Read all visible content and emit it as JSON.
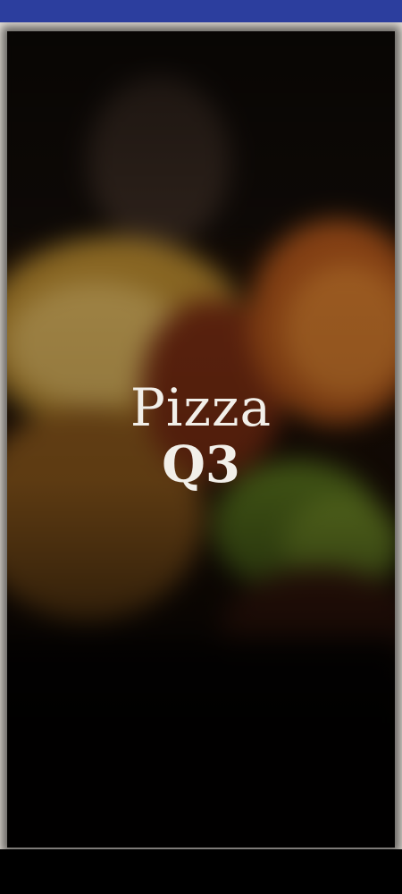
{
  "splash": {
    "title_line1": "Pizza",
    "title_line2": "Q3"
  },
  "colors": {
    "status_bar": "#2c3e9e",
    "title_text": "#f2efe9",
    "frame": "#e6e1da"
  }
}
